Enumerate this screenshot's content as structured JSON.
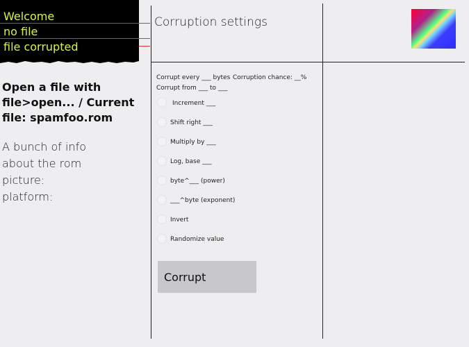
{
  "console": {
    "lines": [
      "Welcome",
      "no file",
      "file corrupted"
    ]
  },
  "settings": {
    "title": "Corruption settings",
    "corrupt_every": "Corrupt every ___ bytes",
    "corruption_chance": "Corruption chance: __%",
    "corrupt_from": "Corrupt from ___ to ___",
    "options": [
      "Increment ___",
      "Shift right ___",
      "Multiply by ___",
      "Log, base ___",
      "byte^___ (power)",
      "___^byte (exponent)",
      "Invert",
      "Randomize value"
    ],
    "corrupt_button": "Corrupt"
  },
  "file_info": {
    "instructions": "Open a file with file>open... / Current file: spamfoo.rom",
    "info_lines": [
      "A bunch of info",
      "about the rom",
      "picture:",
      "platform:"
    ]
  },
  "colors": {
    "console_bg": "#000000",
    "console_text": "#d6f542",
    "annotation_line": "#dd3333",
    "button_bg": "#c8c8ca"
  }
}
